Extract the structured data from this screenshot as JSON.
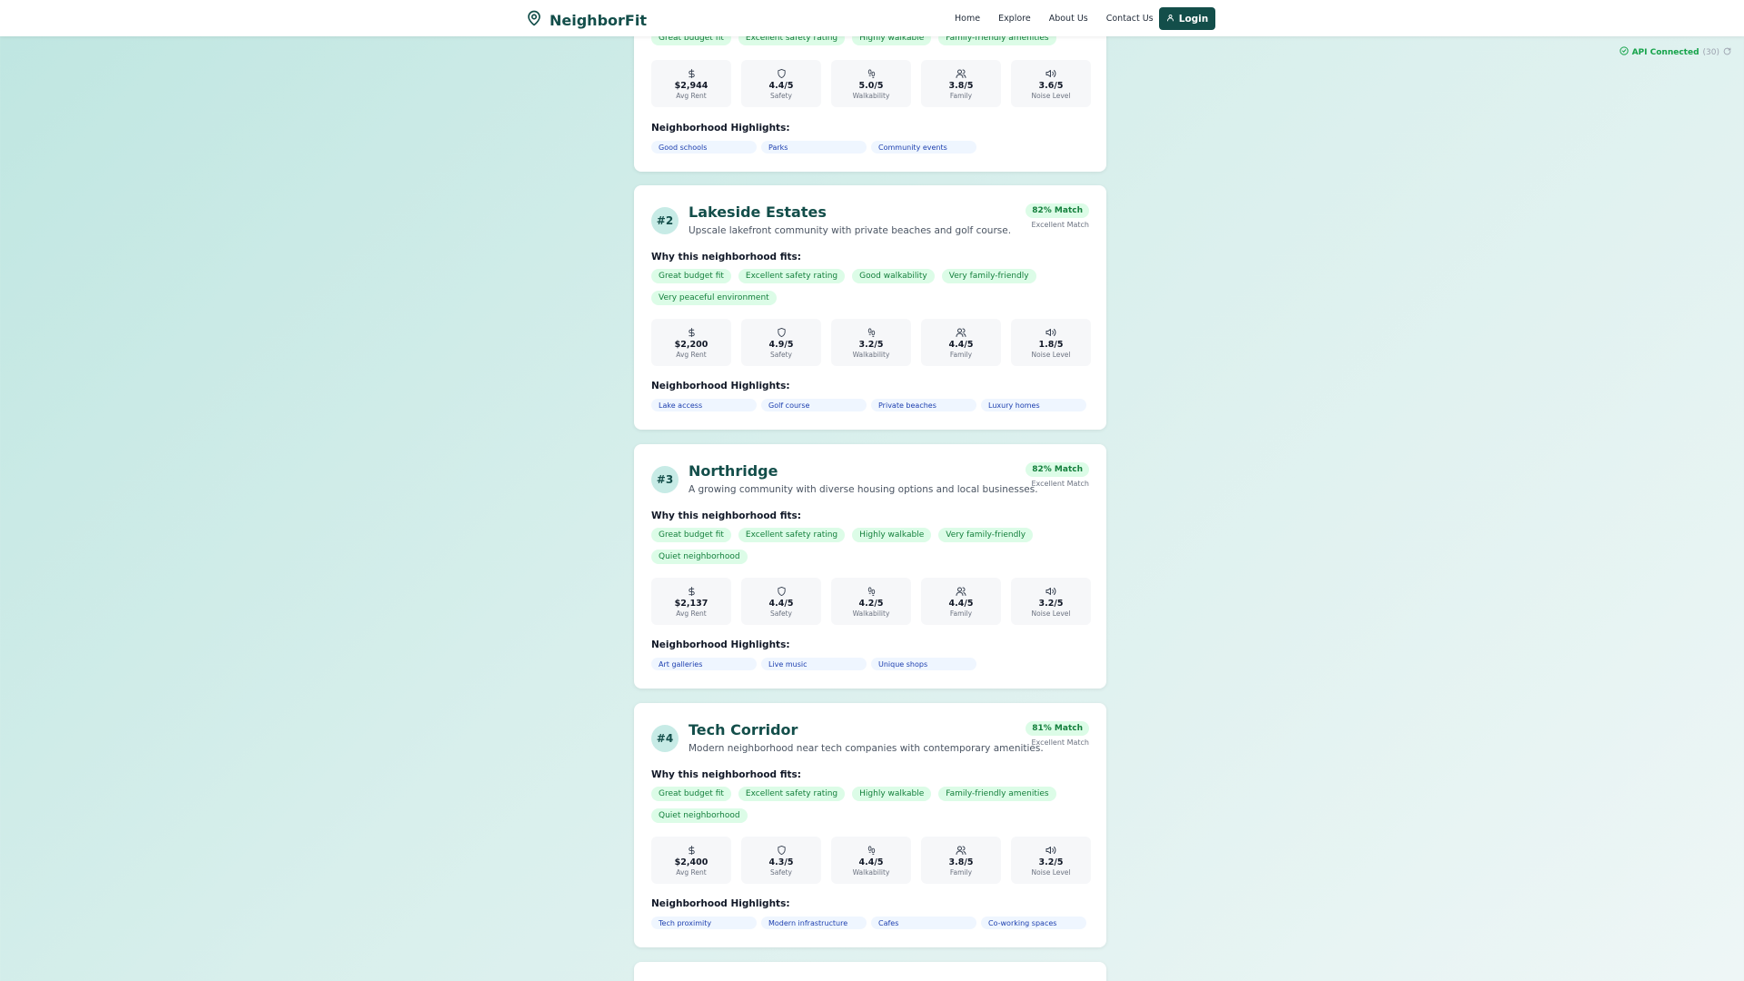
{
  "header": {
    "brand": "NeighborFit",
    "nav": [
      "Home",
      "Explore",
      "About Us",
      "Contact Us"
    ],
    "login_label": "Login"
  },
  "api_status": {
    "label": "API Connected",
    "count": "(30)"
  },
  "colors": {
    "brand": "#134e4a",
    "match": "#15803d",
    "chip_bg": "#dcfce7",
    "highlight_text": "#1e40af"
  },
  "labels": {
    "why_fits": "Why this neighborhood fits:",
    "highlights": "Neighborhood Highlights:",
    "avg_rent": "Avg Rent",
    "safety": "Safety",
    "walkability": "Walkability",
    "family": "Family",
    "noise": "Noise Level"
  },
  "partial_card": {
    "fits": [
      "Great budget fit",
      "Excellent safety rating",
      "Highly walkable",
      "Family-friendly amenities"
    ],
    "stats": {
      "rent": "$2,944",
      "safety": "4.4/5",
      "walkability": "5.0/5",
      "family": "3.8/5",
      "noise": "3.6/5"
    },
    "highlights": [
      "Good schools",
      "Parks",
      "Community events"
    ]
  },
  "cards": [
    {
      "rank": "#2",
      "name": "Lakeside Estates",
      "description": "Upscale lakefront community with private beaches and golf course.",
      "match": "82% Match",
      "match_label": "Excellent Match",
      "fits": [
        "Great budget fit",
        "Excellent safety rating",
        "Good walkability",
        "Very family-friendly",
        "Very peaceful environment"
      ],
      "stats": {
        "rent": "$2,200",
        "safety": "4.9/5",
        "walkability": "3.2/5",
        "family": "4.4/5",
        "noise": "1.8/5"
      },
      "highlights": [
        "Lake access",
        "Golf course",
        "Private beaches",
        "Luxury homes"
      ]
    },
    {
      "rank": "#3",
      "name": "Northridge",
      "description": "A growing community with diverse housing options and local businesses.",
      "match": "82% Match",
      "match_label": "Excellent Match",
      "fits": [
        "Great budget fit",
        "Excellent safety rating",
        "Highly walkable",
        "Very family-friendly",
        "Quiet neighborhood"
      ],
      "stats": {
        "rent": "$2,137",
        "safety": "4.4/5",
        "walkability": "4.2/5",
        "family": "4.4/5",
        "noise": "3.2/5"
      },
      "highlights": [
        "Art galleries",
        "Live music",
        "Unique shops"
      ]
    },
    {
      "rank": "#4",
      "name": "Tech Corridor",
      "description": "Modern neighborhood near tech companies with contemporary amenities.",
      "match": "81% Match",
      "match_label": "Excellent Match",
      "fits": [
        "Great budget fit",
        "Excellent safety rating",
        "Highly walkable",
        "Family-friendly amenities",
        "Quiet neighborhood"
      ],
      "stats": {
        "rent": "$2,400",
        "safety": "4.3/5",
        "walkability": "4.4/5",
        "family": "3.8/5",
        "noise": "3.2/5"
      },
      "highlights": [
        "Tech proximity",
        "Modern infrastructure",
        "Cafes",
        "Co-working spaces"
      ]
    }
  ]
}
